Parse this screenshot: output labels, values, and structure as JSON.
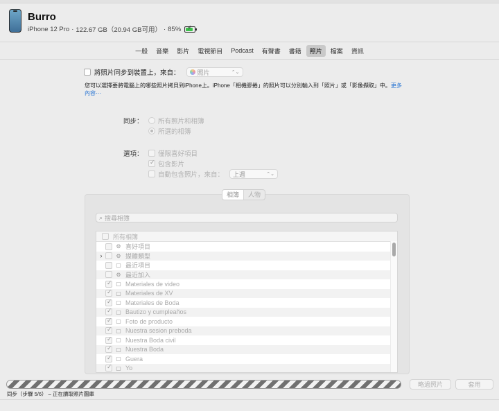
{
  "device": {
    "name": "Burro",
    "model": "iPhone 12 Pro",
    "capacity": "122.67 GB（20.94 GB可用）",
    "battery_percent": "85%"
  },
  "tabs": [
    {
      "label": "一般"
    },
    {
      "label": "音樂"
    },
    {
      "label": "影片"
    },
    {
      "label": "電視節目"
    },
    {
      "label": "Podcast"
    },
    {
      "label": "有聲書"
    },
    {
      "label": "書籍"
    },
    {
      "label": "照片",
      "active": true
    },
    {
      "label": "檔案"
    },
    {
      "label": "資訊"
    }
  ],
  "sync": {
    "checkbox_label": "將照片同步到裝置上，來自：",
    "source_value": "照片",
    "description": "您可以選擇要將電腦上的哪些照片拷貝到iPhone上。iPhone「相機膠捲」的照片可以分別輸入到「照片」或「影像擷取」中。",
    "more_link": "更多內容⋯"
  },
  "sync_options": {
    "label": "同步：",
    "all": "所有照片和相簿",
    "selected": "所選的相簿"
  },
  "options": {
    "label": "選項：",
    "favorites": "僅限喜好項目",
    "videos": "包含影片",
    "auto_include": "自動包含照片，來自：",
    "auto_include_value": "上週"
  },
  "segmented": {
    "albums": "相簿",
    "people": "人物"
  },
  "search": {
    "placeholder": "搜尋相簿"
  },
  "album_list": {
    "header": "所有相簿",
    "rows": [
      {
        "name": "喜好項目",
        "icon": "smart",
        "checked": false,
        "disclosure": false
      },
      {
        "name": "媒體類型",
        "icon": "smart",
        "checked": false,
        "disclosure": true
      },
      {
        "name": "最近項目",
        "icon": "album",
        "checked": false,
        "disclosure": false
      },
      {
        "name": "最近加入",
        "icon": "smart",
        "checked": false,
        "disclosure": false
      },
      {
        "name": "Materiales de video",
        "icon": "album",
        "checked": true,
        "disclosure": false
      },
      {
        "name": "Materiales de XV",
        "icon": "album",
        "checked": true,
        "disclosure": false
      },
      {
        "name": "Materiales de Boda",
        "icon": "album",
        "checked": true,
        "disclosure": false
      },
      {
        "name": "Bautizo y cumpleaños",
        "icon": "album",
        "checked": true,
        "disclosure": false
      },
      {
        "name": "Foto de producto",
        "icon": "album",
        "checked": true,
        "disclosure": false
      },
      {
        "name": "Nuestra sesion preboda",
        "icon": "album",
        "checked": true,
        "disclosure": false
      },
      {
        "name": "Nuestra Boda civil",
        "icon": "album",
        "checked": true,
        "disclosure": false
      },
      {
        "name": "Nuestra Boda",
        "icon": "album",
        "checked": true,
        "disclosure": false
      },
      {
        "name": "Guera",
        "icon": "album",
        "checked": true,
        "disclosure": false
      },
      {
        "name": "Yo",
        "icon": "album",
        "checked": true,
        "disclosure": false
      }
    ]
  },
  "buttons": {
    "skip": "略過照片",
    "apply": "套用"
  },
  "status": "同步（步驟 5/6） – 正在讀取照片圖庫",
  "colors": {
    "accent": "#1f6fd2",
    "battery": "#3cc24a"
  }
}
